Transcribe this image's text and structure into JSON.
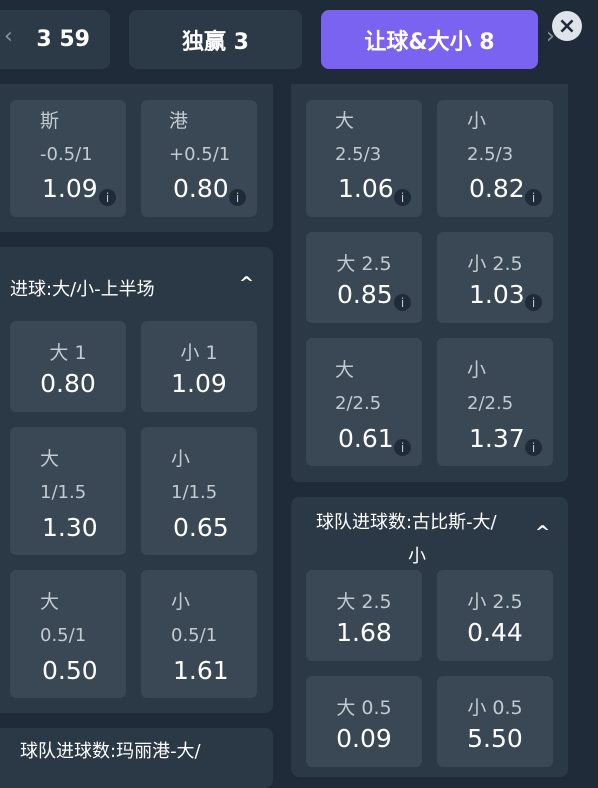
{
  "tabs": [
    {
      "label": "3 59"
    },
    {
      "label": "独赢 3"
    },
    {
      "label": "让球&大小 8"
    }
  ],
  "nav": {
    "prev": "‹",
    "next": "›",
    "close": "×"
  },
  "left": {
    "top_cells": [
      {
        "label": "斯",
        "sub": "-0.5/1",
        "odd": "1.09"
      },
      {
        "label": "港",
        "sub": "+0.5/1",
        "odd": "0.80"
      }
    ],
    "half_title": "进球:大/小-上半场",
    "half_cells": [
      {
        "label": "大 1",
        "odd": "0.80"
      },
      {
        "label": "小 1",
        "odd": "1.09"
      },
      {
        "label": "大",
        "sub": "1/1.5",
        "odd": "1.30"
      },
      {
        "label": "小",
        "sub": "1/1.5",
        "odd": "0.65"
      },
      {
        "label": "大",
        "sub": "0.5/1",
        "odd": "0.50"
      },
      {
        "label": "小",
        "sub": "0.5/1",
        "odd": "1.61"
      }
    ],
    "team_title": "球队进球数:玛丽港-大/"
  },
  "right": {
    "top_cells": [
      {
        "label": "大",
        "sub": "2.5/3",
        "odd": "1.06"
      },
      {
        "label": "小",
        "sub": "2.5/3",
        "odd": "0.82"
      },
      {
        "label": "大 2.5",
        "odd": "0.85"
      },
      {
        "label": "小 2.5",
        "odd": "1.03"
      },
      {
        "label": "大",
        "sub": "2/2.5",
        "odd": "0.61"
      },
      {
        "label": "小",
        "sub": "2/2.5",
        "odd": "1.37"
      }
    ],
    "team_title_1": "球队进球数:古比斯-大/",
    "team_title_2": "小",
    "team_cells": [
      {
        "label": "大 2.5",
        "odd": "1.68"
      },
      {
        "label": "小 2.5",
        "odd": "0.44"
      },
      {
        "label": "大 0.5",
        "odd": "0.09"
      },
      {
        "label": "小 0.5",
        "odd": "5.50"
      }
    ]
  },
  "info_icon": "i",
  "collapse_icon": "^"
}
